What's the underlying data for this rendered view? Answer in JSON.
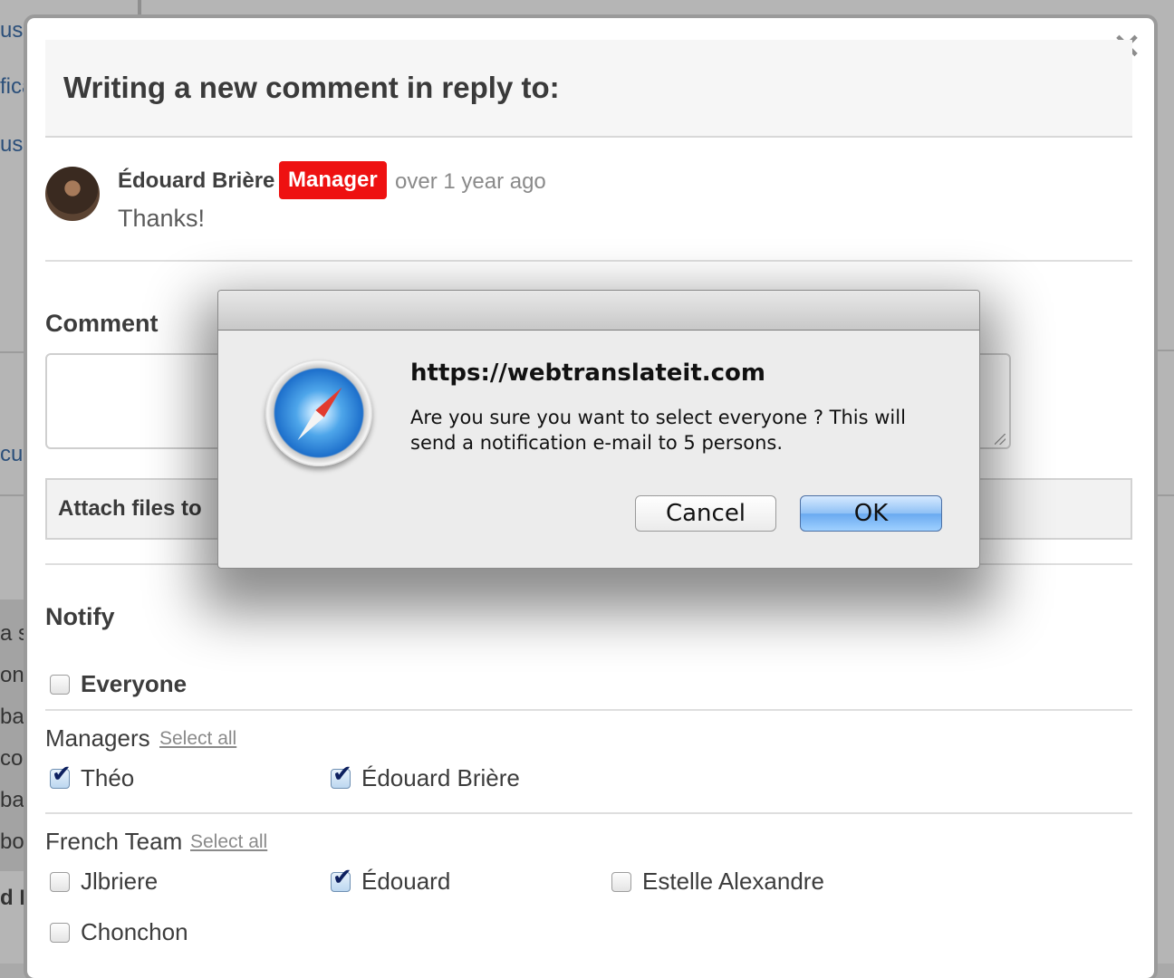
{
  "background": {
    "fragments": [
      "us",
      "fica",
      "uss",
      "cus",
      "a s",
      "onv",
      "bas",
      "con",
      "ba",
      "bol",
      "d B"
    ]
  },
  "modal": {
    "close_icon": "×",
    "title": "Writing a new comment in reply to:",
    "reply": {
      "author": "Édouard Brière",
      "badge": "Manager",
      "time": "over 1 year ago",
      "text": "Thanks!"
    },
    "comment_label": "Comment",
    "attach_label": "Attach files to",
    "notify": {
      "title": "Notify",
      "everyone": {
        "label": "Everyone",
        "checked": false
      },
      "groups": [
        {
          "name": "Managers",
          "select_all": "Select all",
          "members": [
            {
              "label": "Théo",
              "checked": true
            },
            {
              "label": "Édouard Brière",
              "checked": true
            }
          ]
        },
        {
          "name": "French Team",
          "select_all": "Select all",
          "members": [
            {
              "label": "Jlbriere",
              "checked": false
            },
            {
              "label": "Édouard",
              "checked": true
            },
            {
              "label": "Estelle Alexandre",
              "checked": false
            },
            {
              "label": "Chonchon",
              "checked": false
            }
          ]
        }
      ]
    }
  },
  "alert": {
    "icon": "safari-compass-icon",
    "host": "https://webtranslateit.com",
    "message": "Are you sure you want to select everyone ? This will send a notification e-mail to 5 persons.",
    "cancel_label": "Cancel",
    "ok_label": "OK"
  },
  "colors": {
    "badge": "#ee1111",
    "ok_button": "#6aaaf0",
    "overlay": "#a9a9a9"
  }
}
